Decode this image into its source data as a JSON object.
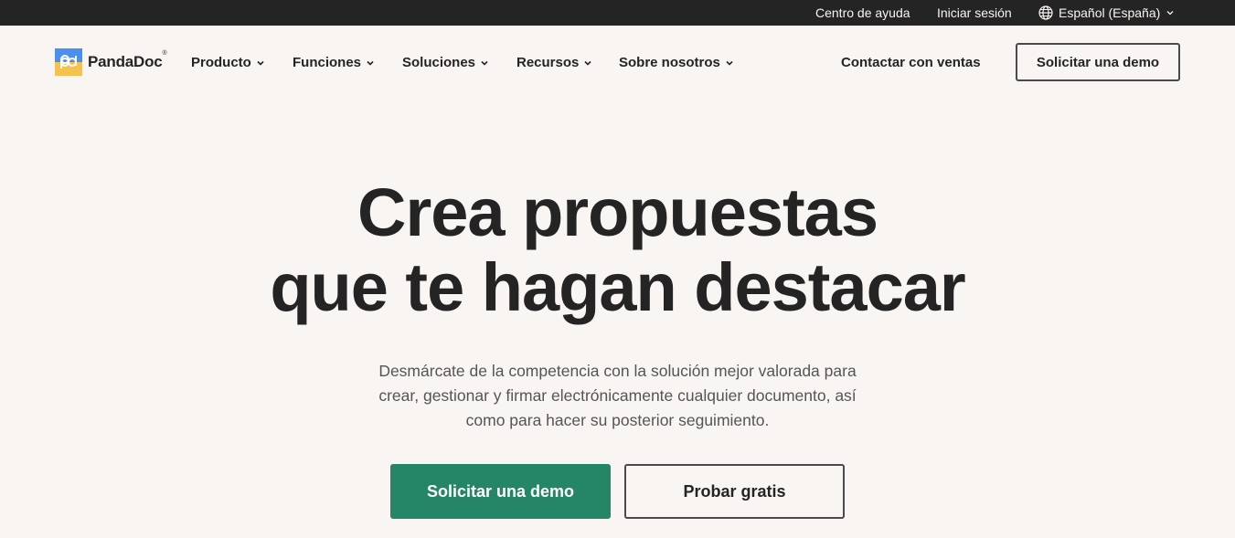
{
  "topbar": {
    "help": "Centro de ayuda",
    "login": "Iniciar sesión",
    "language": "Español (España)",
    "language_icon": "globe-icon"
  },
  "nav": {
    "logo_text": "PandaDoc",
    "logo_mark": "®",
    "menu": [
      {
        "label": "Producto"
      },
      {
        "label": "Funciones"
      },
      {
        "label": "Soluciones"
      },
      {
        "label": "Recursos"
      },
      {
        "label": "Sobre nosotros"
      }
    ],
    "contact": "Contactar con ventas",
    "demo": "Solicitar una demo"
  },
  "hero": {
    "title_line1": "Crea propuestas",
    "title_line2": "que te hagan destacar",
    "subtitle_line1": "Desmárcate de la competencia con la solución mejor valorada para",
    "subtitle_line2": "crear, gestionar y firmar electrónicamente cualquier documento, así",
    "subtitle_line3": "como para hacer su posterior seguimiento.",
    "primary_cta": "Solicitar una demo",
    "secondary_cta": "Probar gratis"
  },
  "colors": {
    "background": "#f8f5f3",
    "topbar": "#242424",
    "primary": "#248567",
    "text": "#242424",
    "logo_blue": "#4a8ef0",
    "logo_yellow": "#f5c24e"
  }
}
